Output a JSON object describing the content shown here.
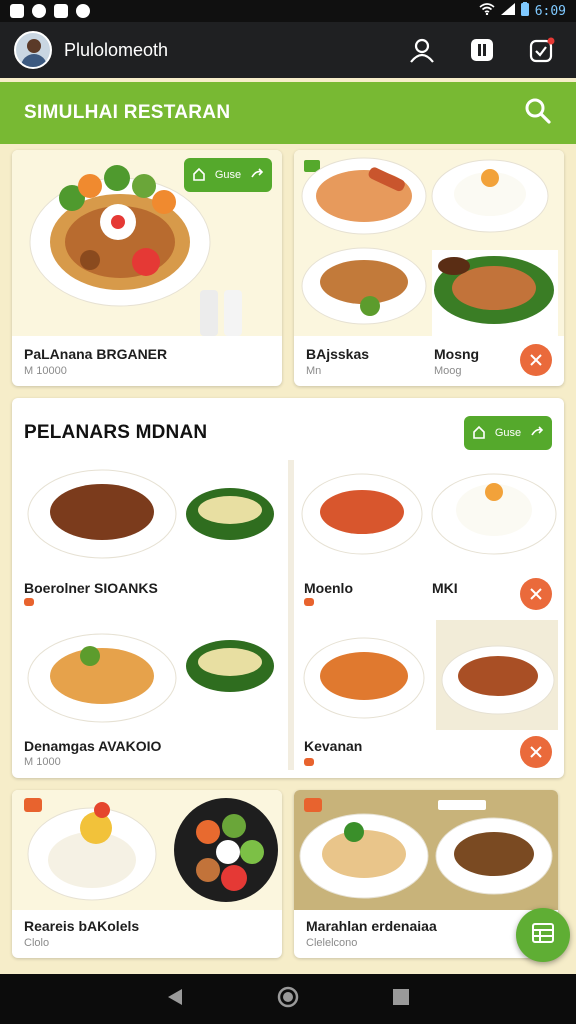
{
  "status": {
    "time": "6:09"
  },
  "appbar": {
    "name": "Plulolomeoth",
    "icons": [
      "person-icon",
      "pause-icon",
      "notification-icon"
    ]
  },
  "search": {
    "title": "SIMULHAI RESTARAN",
    "icon": "search-icon"
  },
  "colors": {
    "green": "#78b933",
    "dark": "#1f2022",
    "orange": "#ea6a3b",
    "cream": "#f6edc9"
  },
  "top_cards": [
    {
      "title": "PaLAnana BRGANER",
      "sub": "M 10000",
      "button": "Guse"
    },
    {
      "title": "BAjsskas",
      "sub": "Mn",
      "title2": "Mosng",
      "sub2": "Moog"
    }
  ],
  "section": {
    "title": "PELANARS MDNAN",
    "button": "Guse",
    "items": [
      {
        "title": "Boerolner SIOANKS"
      },
      {
        "title": "Moenlo",
        "title2": "MKI"
      },
      {
        "title": "Denamgas AVAKOIO",
        "sub": "M 1000"
      },
      {
        "title": "Kevanan"
      }
    ]
  },
  "bottom_cards": [
    {
      "title": "Reareis bAKolels",
      "sub": "Clolo"
    },
    {
      "title": "Marahlan erdenaiaa",
      "sub": "Clelelcono"
    }
  ],
  "fab": {
    "icon": "table-icon"
  }
}
